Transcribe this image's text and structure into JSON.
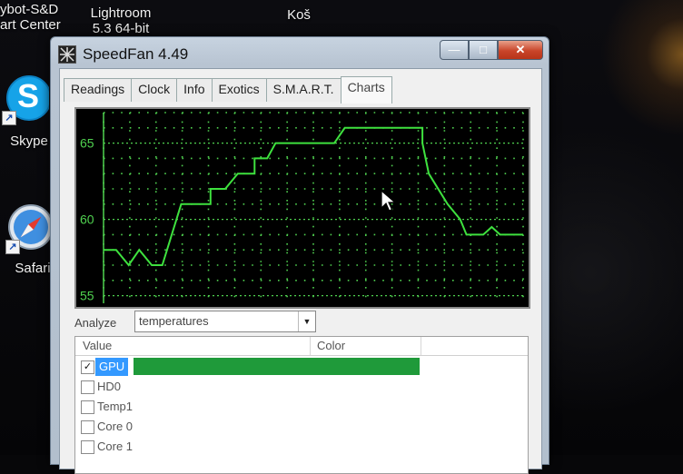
{
  "desktop": {
    "icons": [
      {
        "name": "Skybot-S&D Smart Center",
        "line1": "ybot-S&D",
        "line2": "art Center"
      },
      {
        "name": "Lightroom",
        "line1": "Lightroom",
        "line2": "5.3 64-bit"
      },
      {
        "name": "Koš",
        "line1": "Koš"
      },
      {
        "name": "Skype",
        "line1": "Skype",
        "glyph": "S"
      },
      {
        "name": "Safari",
        "line1": "Safari"
      }
    ]
  },
  "window": {
    "title": "SpeedFan 4.49",
    "controls": {
      "minimize": "—",
      "maximize": "□",
      "close": "✕"
    }
  },
  "tabs": [
    {
      "label": "Readings",
      "active": false
    },
    {
      "label": "Clock",
      "active": false
    },
    {
      "label": "Info",
      "active": false
    },
    {
      "label": "Exotics",
      "active": false
    },
    {
      "label": "S.M.A.R.T.",
      "active": false
    },
    {
      "label": "Charts",
      "active": true
    }
  ],
  "chart_data": {
    "type": "line",
    "ytick_labels": [
      "65",
      "60",
      "55"
    ],
    "ylim": [
      54.5,
      67
    ],
    "grid": true,
    "colors": {
      "background": "#000000",
      "grid": "#4fd04f",
      "line": "#3ee13e"
    },
    "series": [
      {
        "color": "#3ee13e",
        "points": [
          [
            0,
            58
          ],
          [
            0.03,
            58
          ],
          [
            0.06,
            57
          ],
          [
            0.085,
            58
          ],
          [
            0.115,
            57
          ],
          [
            0.14,
            57
          ],
          [
            0.185,
            61
          ],
          [
            0.255,
            61
          ],
          [
            0.255,
            62
          ],
          [
            0.29,
            62
          ],
          [
            0.32,
            63
          ],
          [
            0.36,
            63
          ],
          [
            0.36,
            64
          ],
          [
            0.39,
            64
          ],
          [
            0.41,
            65
          ],
          [
            0.5,
            65
          ],
          [
            0.5,
            65
          ],
          [
            0.55,
            65
          ],
          [
            0.575,
            66
          ],
          [
            0.76,
            66
          ],
          [
            0.76,
            65
          ],
          [
            0.775,
            63
          ],
          [
            0.82,
            61
          ],
          [
            0.85,
            60
          ],
          [
            0.865,
            59
          ],
          [
            0.905,
            59
          ],
          [
            0.925,
            59.5
          ],
          [
            0.945,
            59
          ],
          [
            0.975,
            59
          ],
          [
            1.0,
            59
          ]
        ]
      }
    ]
  },
  "analyze": {
    "label": "Analyze",
    "selected": "temperatures"
  },
  "list": {
    "columns": [
      "Value",
      "Color"
    ],
    "rows": [
      {
        "label": "GPU",
        "checked": true,
        "selected": true,
        "color": "#1f9a3a"
      },
      {
        "label": "HD0",
        "checked": false,
        "selected": false,
        "color": ""
      },
      {
        "label": "Temp1",
        "checked": false,
        "selected": false,
        "color": ""
      },
      {
        "label": "Core 0",
        "checked": false,
        "selected": false,
        "color": ""
      },
      {
        "label": "Core 1",
        "checked": false,
        "selected": false,
        "color": ""
      }
    ]
  }
}
